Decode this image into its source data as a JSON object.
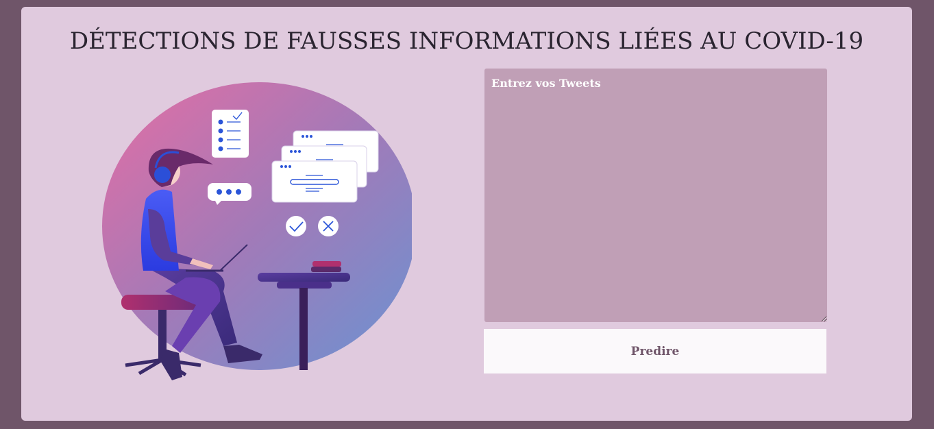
{
  "page": {
    "title": "DÉTECTIONS DE FAUSSES INFORMATIONS LIÉES AU COVID-19"
  },
  "form": {
    "tweet_placeholder": "Entrez vos Tweets",
    "tweet_value": "",
    "submit_label": "Predire"
  },
  "colors": {
    "page_background": "#6f5569",
    "card_background": "#e0cade",
    "input_background": "#c09fb6",
    "button_background": "#fbf9fb",
    "button_text": "#6f5569",
    "title_text": "#2a2430"
  },
  "illustration": {
    "icons": [
      "person-at-laptop-icon",
      "checklist-icon",
      "chat-bubble-icon",
      "tweet-cards-icon",
      "check-icon",
      "cross-icon"
    ]
  }
}
